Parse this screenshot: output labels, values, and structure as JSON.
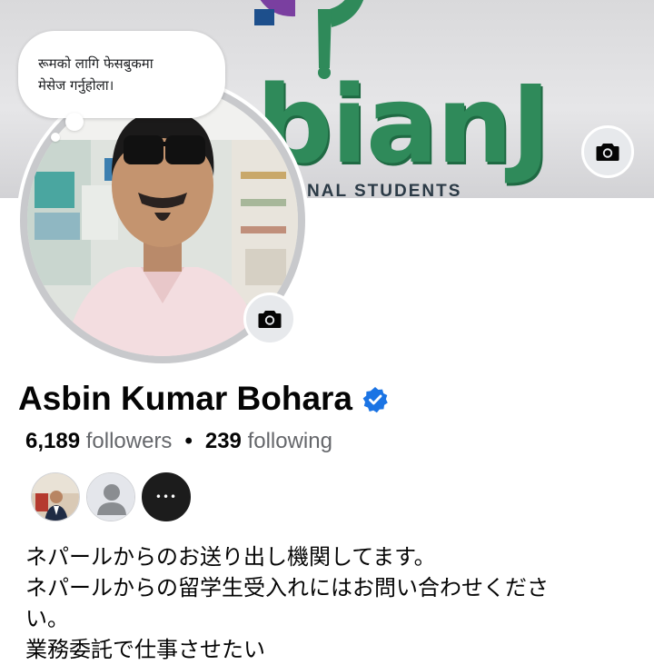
{
  "cover": {
    "brand_text": "bianJ",
    "subtitle_text": "NAL  STUDENTS",
    "camera_icon": "camera-icon"
  },
  "profile_note": {
    "text": "रूमको लागि फेसबुकमा\nमेसेज गर्नुहोला।"
  },
  "avatar": {
    "camera_icon": "camera-icon"
  },
  "profile": {
    "name": "Asbin Kumar Bohara",
    "verified_icon": "verified-badge-icon",
    "followers_count": "6,189",
    "followers_label": "followers",
    "separator": "•",
    "following_count": "239",
    "following_label": "following"
  },
  "mutual_friends": {
    "more_label": "•••"
  },
  "bio": {
    "lines": [
      "ネパールからのお送り出し機関してます。",
      "ネパールからの留学生受入れにはお問い合わせくださ",
      "い。",
      "業務委託で仕事させたい"
    ]
  },
  "colors": {
    "brand_green": "#2f8a5a",
    "verified_blue": "#1b74e4",
    "secondary_text": "#65676b",
    "camera_button_bg": "#e7e9ec"
  }
}
